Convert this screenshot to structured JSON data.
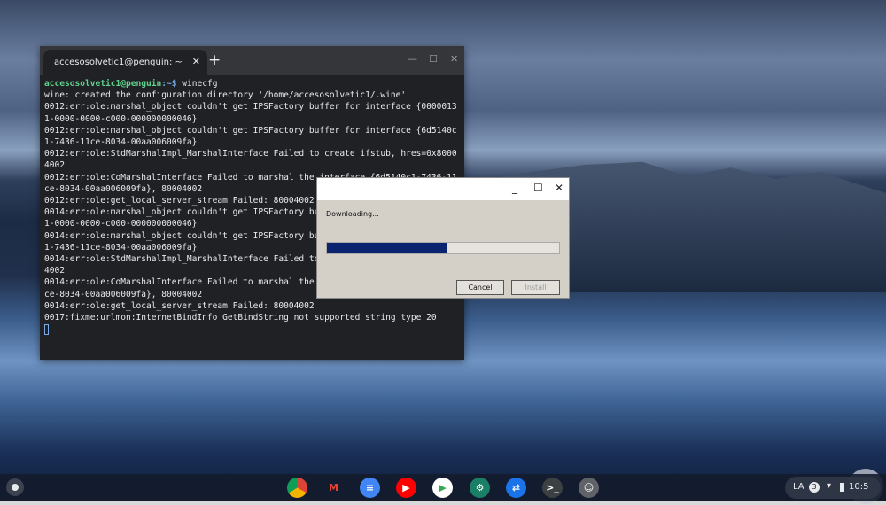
{
  "terminal": {
    "tab_title": "accesosolvetic1@penguin: ~",
    "prompt_user": "accesosolvetic1@penguin",
    "prompt_path": ":~$ ",
    "command": "winecfg",
    "lines": [
      "wine: created the configuration directory '/home/accesosolvetic1/.wine'",
      "0012:err:ole:marshal_object couldn't get IPSFactory buffer for interface {0000013",
      "1-0000-0000-c000-000000000046}",
      "0012:err:ole:marshal_object couldn't get IPSFactory buffer for interface {6d5140c",
      "1-7436-11ce-8034-00aa006009fa}",
      "0012:err:ole:StdMarshalImpl_MarshalInterface Failed to create ifstub, hres=0x8000",
      "4002",
      "0012:err:ole:CoMarshalInterface Failed to marshal the interface {6d5140c1-7436-11",
      "ce-8034-00aa006009fa}, 80004002",
      "0012:err:ole:get_local_server_stream Failed: 80004002",
      "0014:err:ole:marshal_object couldn't get IPSFactory bu",
      "1-0000-0000-c000-000000000046}",
      "0014:err:ole:marshal_object couldn't get IPSFactory bu",
      "1-7436-11ce-8034-00aa006009fa}",
      "0014:err:ole:StdMarshalImpl_MarshalInterface Failed to",
      "4002",
      "0014:err:ole:CoMarshalInterface Failed to marshal the",
      "ce-8034-00aa006009fa}, 80004002",
      "0014:err:ole:get_local_server_stream Failed: 80004002",
      "0017:fixme:urlmon:InternetBindInfo_GetBindString not supported string type 20"
    ]
  },
  "dialog": {
    "status": "Downloading...",
    "progress_percent": 52,
    "cancel_label": "Cancel",
    "install_label": "Install"
  },
  "shelf": {
    "apps": [
      "chrome-icon",
      "gmail-icon",
      "docs-icon",
      "youtube-icon",
      "play-store-icon",
      "settings-icon",
      "remote-desktop-icon",
      "terminal-icon",
      "linux-penguin-icon"
    ],
    "tray": {
      "ime": "LA",
      "notifications": "3",
      "time": "10:5"
    }
  }
}
